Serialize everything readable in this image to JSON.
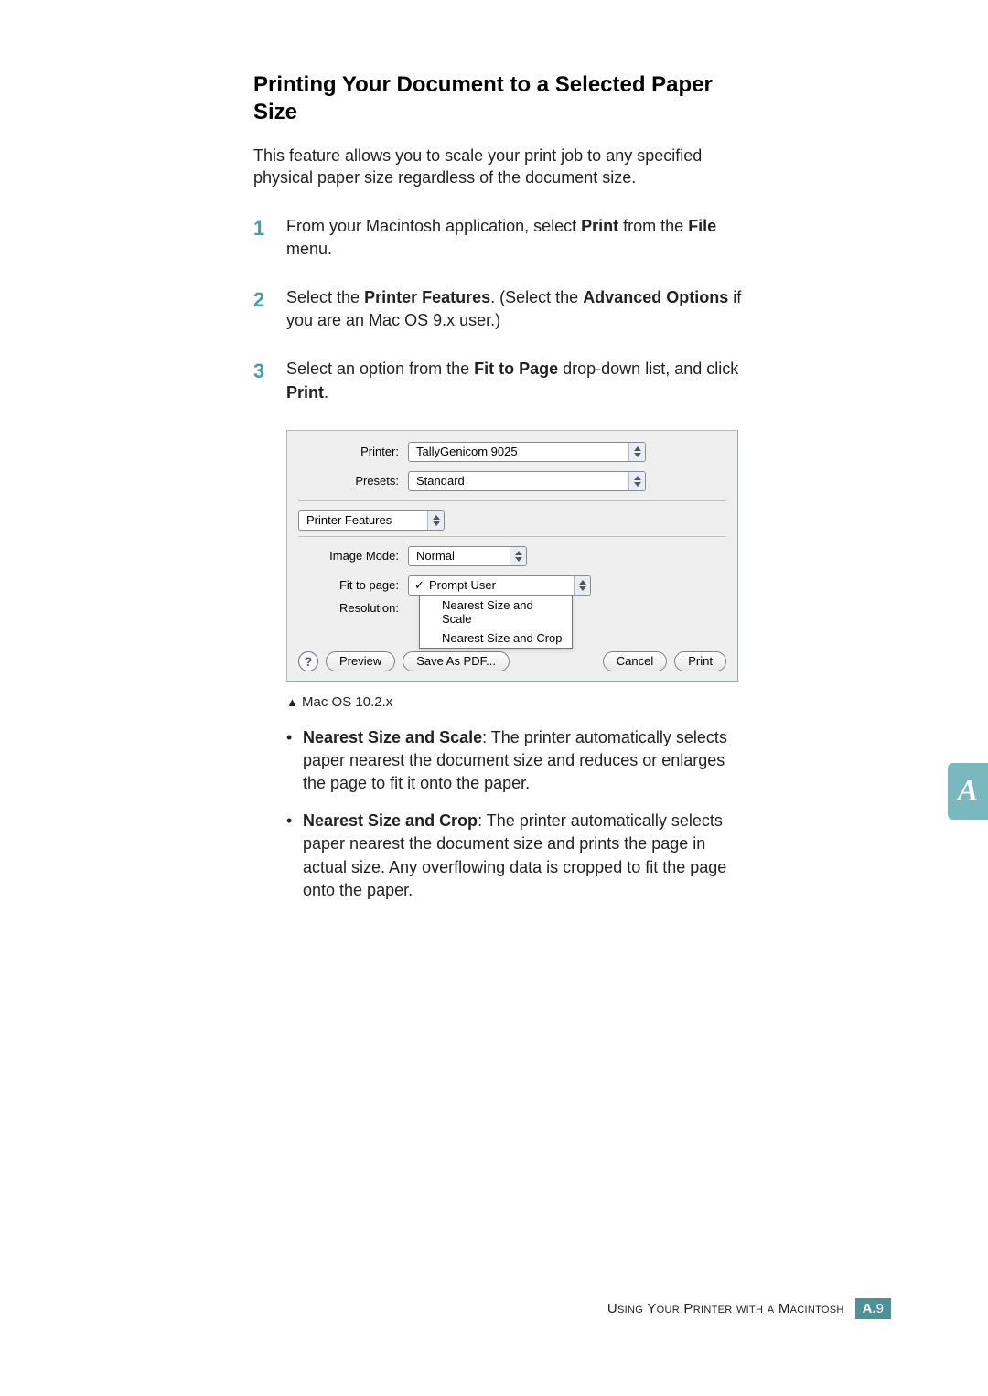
{
  "heading": "Printing Your Document to a Selected Paper Size",
  "intro": "This feature allows you to scale your print job to any specified physical paper size regardless of the document size.",
  "steps": {
    "s1_a": "From your Macintosh application, select ",
    "s1_b": "Print",
    "s1_c": " from the ",
    "s1_d": "File",
    "s1_e": " menu.",
    "s2_a": "Select the ",
    "s2_b": "Printer Features",
    "s2_c": ". (Select the ",
    "s2_d": "Advanced Options",
    "s2_e": " if you are an Mac OS 9.x user.)",
    "s3_a": "Select an option from the ",
    "s3_b": "Fit to Page",
    "s3_c": " drop-down list, and click ",
    "s3_d": "Print",
    "s3_e": "."
  },
  "dialog": {
    "printer_label": "Printer:",
    "printer_value": "TallyGenicom 9025",
    "presets_label": "Presets:",
    "presets_value": "Standard",
    "panel_label": "Printer Features",
    "image_mode_label": "Image Mode:",
    "image_mode_value": "Normal",
    "fit_label": "Fit to page:",
    "resolution_label": "Resolution:",
    "fit_options": {
      "opt1": "Prompt User",
      "opt2": "Nearest Size and Scale",
      "opt3": "Nearest Size and Crop"
    },
    "buttons": {
      "help": "?",
      "preview": "Preview",
      "savepdf": "Save As PDF...",
      "cancel": "Cancel",
      "print": "Print"
    }
  },
  "caption_tri": "▲",
  "caption": " Mac OS 10.2.x",
  "bullets": {
    "b1_t": "Nearest Size and Scale",
    "b1_r": ": The printer automatically selects paper nearest the document size and reduces or enlarges the page to fit it onto the paper.",
    "b2_t": "Nearest Size and Crop",
    "b2_r": ": The printer automatically selects paper nearest the document size and prints the page in actual size. Any overflowing data is cropped to fit the page onto the paper."
  },
  "side_tab": "A",
  "footer": {
    "text_a": "Using Your Printer with a Macintosh",
    "page_bold": "A.",
    "page_num": "9"
  }
}
